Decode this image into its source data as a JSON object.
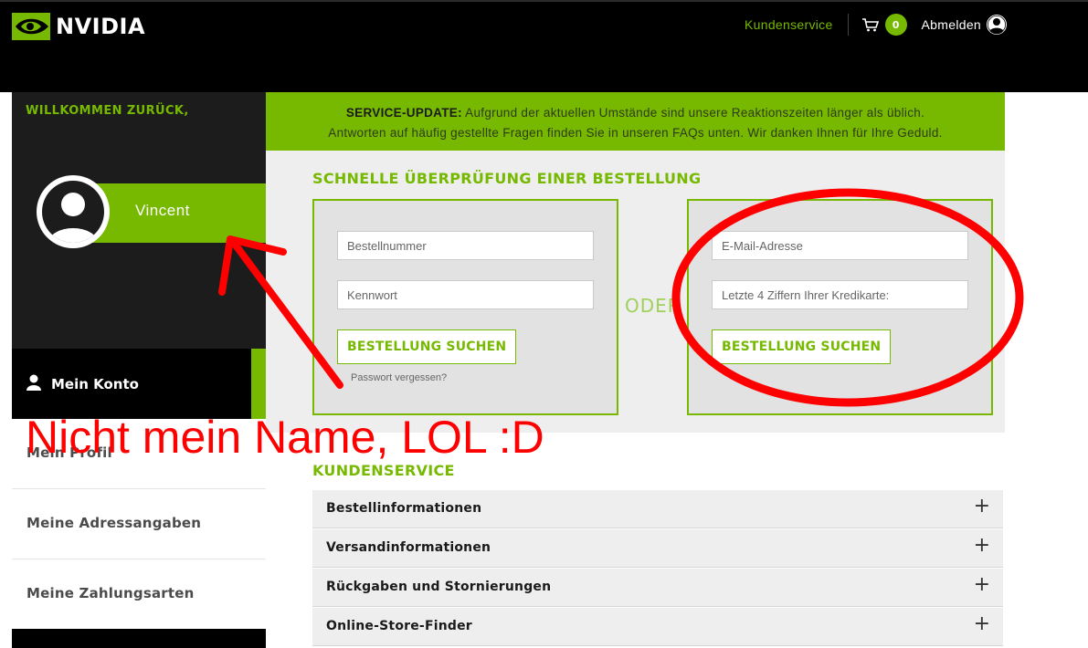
{
  "header": {
    "logo_text": "NVIDIA",
    "customer_service_link": "Kundenservice",
    "cart_count": "0",
    "logout_label": "Abmelden"
  },
  "sidebar": {
    "welcome": "WILLKOMMEN ZURÜCK,",
    "user_name": "Vincent",
    "account_label": "Mein Konto",
    "items": [
      {
        "label": "Mein Profil"
      },
      {
        "label": "Meine Adressangaben"
      },
      {
        "label": "Meine Zahlungsarten"
      }
    ]
  },
  "banner": {
    "bold": "SERVICE-UPDATE:",
    "line1": " Aufgrund der aktuellen Umstände sind unsere Reaktionszeiten länger als üblich.",
    "line2": "Antworten auf häufig gestellte Fragen finden Sie in unseren FAQs unten. Wir danken Ihnen für Ihre Geduld."
  },
  "quick_check": {
    "title": "SCHNELLE ÜBERPRÜFUNG EINER BESTELLUNG",
    "left": {
      "order_number_placeholder": "Bestellnummer",
      "password_placeholder": "Kennwort",
      "button": "BESTELLUNG SUCHEN",
      "forgot_password": "Passwort vergessen?"
    },
    "separator": "ODER",
    "right": {
      "email_placeholder": "E-Mail-Adresse",
      "card_digits_placeholder": "Letzte 4 Ziffern Ihrer Kredikarte:",
      "button": "BESTELLUNG SUCHEN"
    }
  },
  "customer_service": {
    "title": "KUNDENSERVICE",
    "items": [
      {
        "label": "Bestellinformationen"
      },
      {
        "label": "Versandinformationen"
      },
      {
        "label": "Rückgaben und Stornierungen"
      },
      {
        "label": "Online-Store-Finder"
      }
    ]
  },
  "annotation": {
    "text": "Nicht mein Name, LOL :D",
    "color": "#ff0000"
  },
  "colors": {
    "brand_green": "#76b900",
    "header_bg": "#000000",
    "sidebar_bg": "#1c1c1c"
  }
}
